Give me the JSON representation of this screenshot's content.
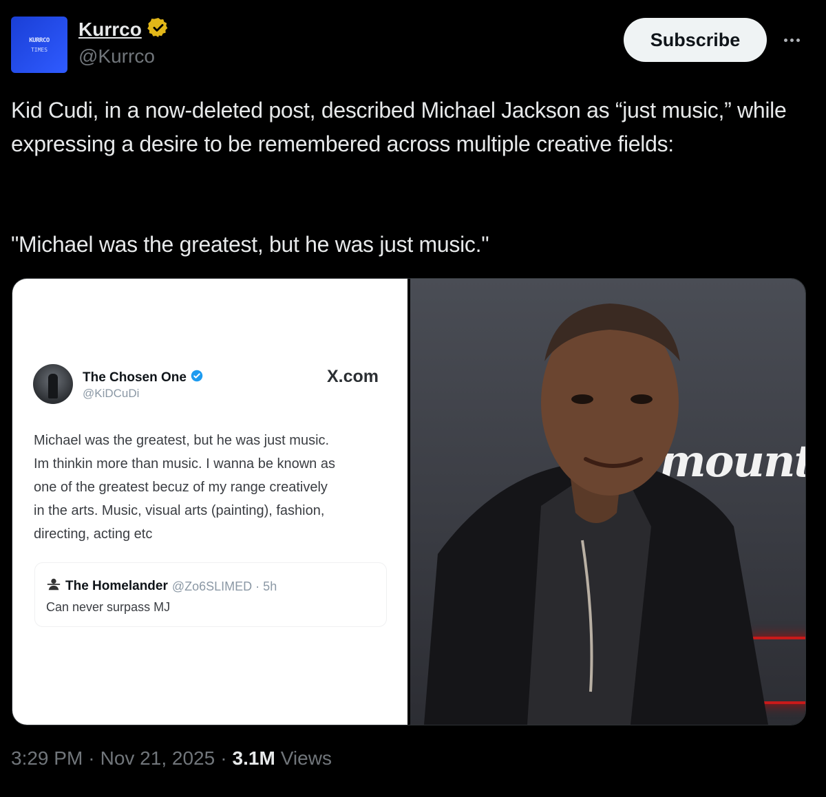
{
  "author": {
    "display_name": "Kurrco",
    "handle": "@Kurrco",
    "avatar_text": "KURRCO",
    "avatar_subtext": "TIMES",
    "verified_badge_color": "#e2b719"
  },
  "subscribe_label": "Subscribe",
  "post": {
    "text": "Kid Cudi, in a now-deleted post, described Michael Jackson as “just music,” while expressing a desire to be remembered across multiple creative fields:",
    "quote": "\"Michael was the greatest, but he was just music.\""
  },
  "media": {
    "screenshot": {
      "name": "The Chosen One",
      "handle": "@KiDCuDi",
      "source": "X.com",
      "verified_badge_color": "#1d9bf0",
      "body": "Michael was the greatest, but he was just music.\nIm thinkin more than music.  I wanna be known as\none of the greatest becuz of my range creatively\nin the arts.  Music, visual arts (painting), fashion,\ndirecting, acting etc",
      "reply": {
        "name": "The Homelander",
        "meta": "@Zo6SLIMED · 5h",
        "text": "Can never surpass MJ"
      }
    },
    "photo": {
      "backdrop_text": "mount"
    }
  },
  "footer": {
    "time": "3:29 PM",
    "separator": "·",
    "date": "Nov 21, 2025",
    "views_count": "3.1M",
    "views_label": "Views"
  }
}
